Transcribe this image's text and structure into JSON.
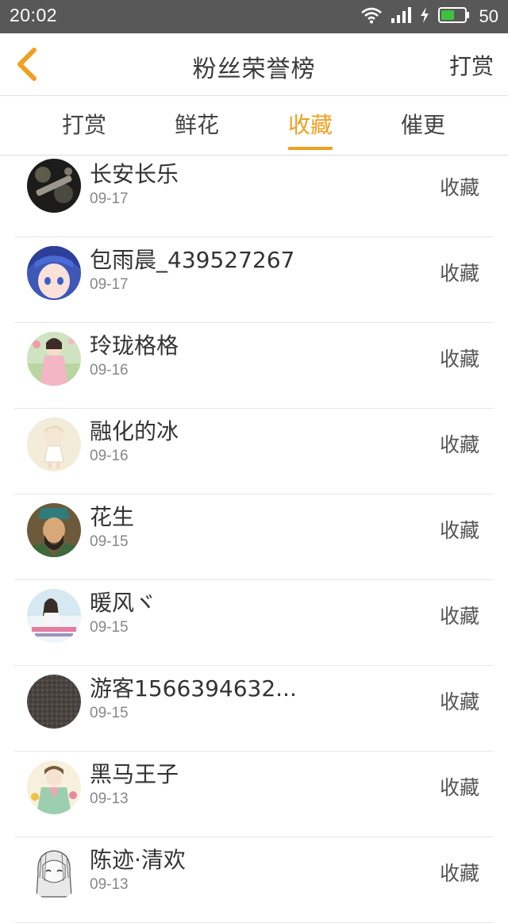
{
  "status": {
    "time": "20:02",
    "battery": "50"
  },
  "nav": {
    "title": "粉丝荣誉榜",
    "right_label": "打赏"
  },
  "tabs": [
    {
      "label": "打赏"
    },
    {
      "label": "鲜花"
    },
    {
      "label": "收藏"
    },
    {
      "label": "催更"
    }
  ],
  "active_tab": "收藏",
  "colors": {
    "accent": "#f0a020",
    "status_bar": "#585858"
  },
  "fans": [
    {
      "name": "长安长乐",
      "date": "09-17",
      "action": "收藏"
    },
    {
      "name": "包雨晨_439527267",
      "date": "09-17",
      "action": "收藏"
    },
    {
      "name": "玲珑格格",
      "date": "09-16",
      "action": "收藏"
    },
    {
      "name": "融化的冰",
      "date": "09-16",
      "action": "收藏"
    },
    {
      "name": "花生",
      "date": "09-15",
      "action": "收藏"
    },
    {
      "name": "暖风ヾ",
      "date": "09-15",
      "action": "收藏"
    },
    {
      "name": "游客1566394632...",
      "date": "09-15",
      "action": "收藏"
    },
    {
      "name": "黑马王子",
      "date": "09-13",
      "action": "收藏"
    },
    {
      "name": "陈迹·清欢",
      "date": "09-13",
      "action": "收藏"
    }
  ]
}
